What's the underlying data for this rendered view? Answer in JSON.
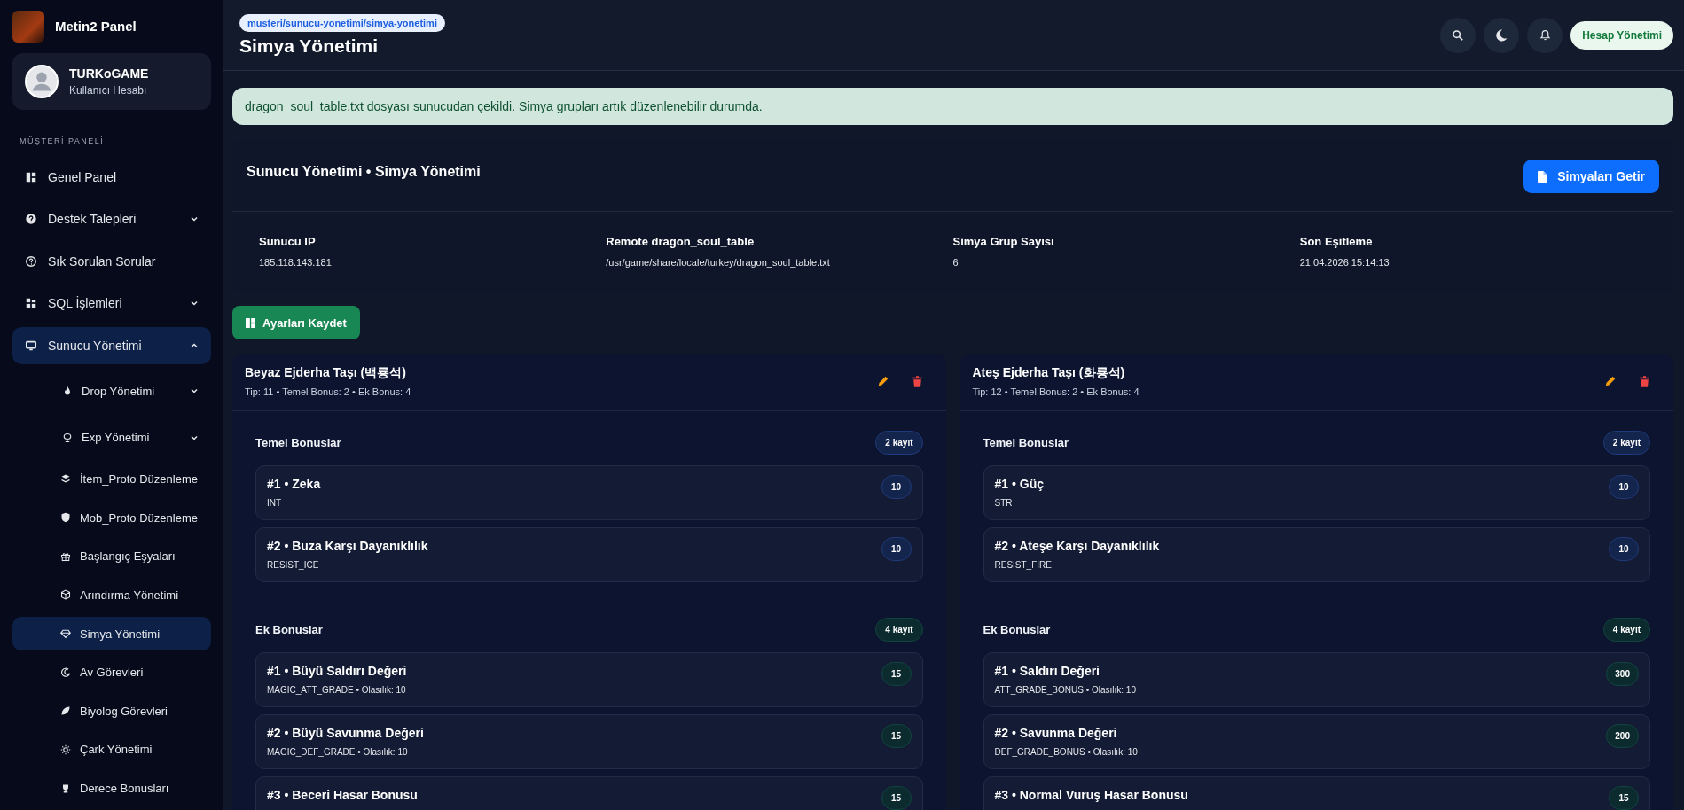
{
  "brand": {
    "title": "Metin2 Panel"
  },
  "user": {
    "name": "TURKoGAME",
    "role": "Kullanıcı Hesabı"
  },
  "sidebar": {
    "section_label": "MÜŞTERİ PANELİ",
    "items": [
      {
        "label": "Genel Panel",
        "selected": false
      },
      {
        "label": "Destek Talepleri",
        "selected": false,
        "expanded": false
      },
      {
        "label": "Sık Sorulan Sorular",
        "selected": false
      },
      {
        "label": "SQL İşlemleri",
        "selected": false,
        "expanded": false
      },
      {
        "label": "Sunucu Yönetimi",
        "selected": true,
        "expanded": true,
        "children": [
          {
            "label": "Drop Yönetimi",
            "selected": false,
            "expanded": false
          },
          {
            "label": "Exp Yönetimi",
            "selected": false,
            "expanded": false
          },
          {
            "label": "İtem_Proto Düzenleme",
            "selected": false
          },
          {
            "label": "Mob_Proto Düzenleme",
            "selected": false
          },
          {
            "label": "Başlangıç Eşyaları",
            "selected": false
          },
          {
            "label": "Arındırma Yönetimi",
            "selected": false
          },
          {
            "label": "Simya Yönetimi",
            "selected": true
          },
          {
            "label": "Av Görevleri",
            "selected": false
          },
          {
            "label": "Biyolog Görevleri",
            "selected": false
          },
          {
            "label": "Çark Yönetimi",
            "selected": false
          },
          {
            "label": "Derece Bonusları",
            "selected": false
          }
        ]
      }
    ]
  },
  "header": {
    "breadcrumb": "musteri/sunucu-yonetimi/simya-yonetimi",
    "title": "Simya Yönetimi",
    "account_button": "Hesap Yönetimi"
  },
  "alert": {
    "message": "dragon_soul_table.txt dosyası sunucudan çekildi. Simya grupları artık düzenlenebilir durumda."
  },
  "info_card": {
    "title": "Sunucu Yönetimi • Simya Yönetimi",
    "button": "Simyaları Getir",
    "fields": [
      {
        "label": "Sunucu IP",
        "value": "185.118.143.181"
      },
      {
        "label": "Remote dragon_soul_table",
        "value": "/usr/game/share/locale/turkey/dragon_soul_table.txt"
      },
      {
        "label": "Simya Grup Sayısı",
        "value": "6"
      },
      {
        "label": "Son Eşitleme",
        "value": "21.04.2026 15:14:13"
      }
    ]
  },
  "save_button": "Ayarları Kaydet",
  "groups": [
    {
      "title": "Beyaz Ejderha Taşı (백룡석)",
      "meta": "Tip: 11 • Temel Bonus: 2 • Ek Bonus: 4",
      "sections": [
        {
          "kind": "base",
          "title": "Temel Bonuslar",
          "count": "2 kayıt",
          "rows": [
            {
              "title": "#1 • Zeka",
              "sub": "INT",
              "value": "10"
            },
            {
              "title": "#2 • Buza Karşı Dayanıklılık",
              "sub": "RESIST_ICE",
              "value": "10"
            }
          ]
        },
        {
          "kind": "extra",
          "title": "Ek Bonuslar",
          "count": "4 kayıt",
          "rows": [
            {
              "title": "#1 • Büyü Saldırı Değeri",
              "sub": "MAGIC_ATT_GRADE • Olasılık: 10",
              "value": "15"
            },
            {
              "title": "#2 • Büyü Savunma Değeri",
              "sub": "MAGIC_DEF_GRADE • Olasılık: 10",
              "value": "15"
            },
            {
              "title": "#3 • Beceri Hasar Bonusu",
              "value": "15"
            }
          ]
        }
      ]
    },
    {
      "title": "Ateş Ejderha Taşı (화룡석)",
      "meta": "Tip: 12 • Temel Bonus: 2 • Ek Bonus: 4",
      "sections": [
        {
          "kind": "base",
          "title": "Temel Bonuslar",
          "count": "2 kayıt",
          "rows": [
            {
              "title": "#1 • Güç",
              "sub": "STR",
              "value": "10"
            },
            {
              "title": "#2 • Ateşe Karşı Dayanıklılık",
              "sub": "RESIST_FIRE",
              "value": "10"
            }
          ]
        },
        {
          "kind": "extra",
          "title": "Ek Bonuslar",
          "count": "4 kayıt",
          "rows": [
            {
              "title": "#1 • Saldırı Değeri",
              "sub": "ATT_GRADE_BONUS • Olasılık: 10",
              "value": "300"
            },
            {
              "title": "#2 • Savunma Değeri",
              "sub": "DEF_GRADE_BONUS • Olasılık: 10",
              "value": "200"
            },
            {
              "title": "#3 • Normal Vuruş Hasar Bonusu",
              "value": "15"
            }
          ]
        }
      ]
    }
  ]
}
